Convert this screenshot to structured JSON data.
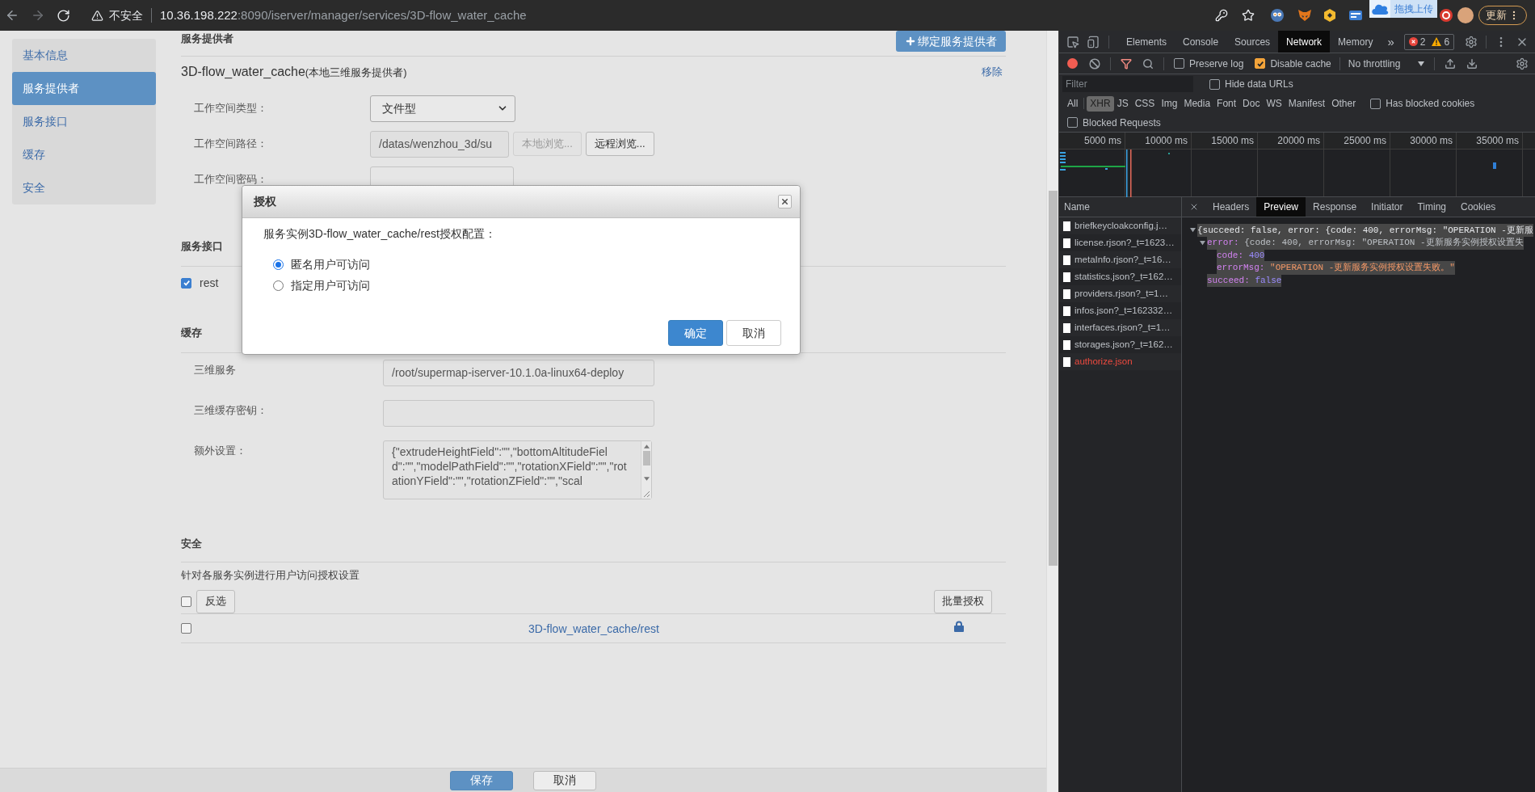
{
  "browser": {
    "security_label": "不安全",
    "url_host": "10.36.198.222",
    "url_rest": ":8090/iserver/manager/services/3D-flow_water_cache",
    "upload_tip": "拖拽上传",
    "update_button": "更新"
  },
  "sidebar": {
    "items": [
      {
        "label": "基本信息",
        "selected": false
      },
      {
        "label": "服务提供者",
        "selected": true
      },
      {
        "label": "服务接口",
        "selected": false
      },
      {
        "label": "缓存",
        "selected": false
      },
      {
        "label": "安全",
        "selected": false
      }
    ]
  },
  "provider": {
    "title": "服务提供者",
    "bind_button": "绑定服务提供者",
    "name": "3D-flow_water_cache",
    "note": "(本地三维服务提供者)",
    "remove_link": "移除",
    "fields": [
      {
        "kind": "select",
        "label": "工作空间类型：",
        "value": "文件型"
      },
      {
        "kind": "path",
        "label": "工作空间路径：",
        "value": "/datas/wenzhou_3d/su",
        "buttons": [
          {
            "label": "本地浏览...",
            "disabled": true
          },
          {
            "label": "远程浏览...",
            "disabled": false
          }
        ]
      },
      {
        "kind": "password",
        "label": "工作空间密码："
      }
    ]
  },
  "interfaces": {
    "title": "服务接口",
    "items": [
      {
        "label": "rest",
        "checked": true
      }
    ]
  },
  "cache": {
    "title": "缓存",
    "fields": [
      {
        "kind": "text",
        "label": "三维服务",
        "value": "/root/supermap-iserver-10.1.0a-linux64-deploy"
      },
      {
        "kind": "text",
        "label": "三维缓存密钥："
      },
      {
        "kind": "textarea",
        "label": "额外设置：",
        "value": "{\"extrudeHeightField\":\"\",\"bottomAltitudeField\":\"\",\"modelPathField\":\"\",\"rotationXField\":\"\",\"rotationYField\":\"\",\"rotationZField\":\"\",\"scal"
      }
    ]
  },
  "security": {
    "title": "安全",
    "description": "针对各服务实例进行用户访问授权设置",
    "select_all_checked": false,
    "invert_button": "反选",
    "batch_button": "批量授权",
    "rows": [
      {
        "name": "3D-flow_water_cache/rest",
        "checked": false
      }
    ]
  },
  "footer": {
    "buttons": [
      {
        "label": "保存",
        "kind": "primary"
      },
      {
        "label": "取消",
        "kind": "default"
      }
    ]
  },
  "dialog": {
    "title": "授权",
    "prompt": "服务实例3D-flow_water_cache/rest授权配置：",
    "options": [
      {
        "label": "匿名用户可访问",
        "selected": true
      },
      {
        "label": "指定用户可访问",
        "selected": false
      }
    ],
    "buttons": [
      {
        "label": "确定",
        "kind": "primary"
      },
      {
        "label": "取消",
        "kind": "default"
      }
    ]
  },
  "devtools": {
    "tabs": [
      {
        "label": "Elements",
        "selected": false
      },
      {
        "label": "Console",
        "selected": false
      },
      {
        "label": "Sources",
        "selected": false
      },
      {
        "label": "Network",
        "selected": true
      },
      {
        "label": "Memory",
        "selected": false
      }
    ],
    "more": "»",
    "errors": "2",
    "warnings": "6",
    "preserve_log": {
      "label": "Preserve log",
      "checked": false
    },
    "disable_cache": {
      "label": "Disable cache",
      "checked": true
    },
    "throttling": "No throttling",
    "filter": {
      "placeholder": "Filter"
    },
    "hide_data_urls": {
      "label": "Hide data URLs",
      "checked": false
    },
    "types": [
      {
        "label": "All",
        "selected": false
      },
      {
        "label": "XHR",
        "selected": true
      },
      {
        "label": "JS",
        "selected": false
      },
      {
        "label": "CSS",
        "selected": false
      },
      {
        "label": "Img",
        "selected": false
      },
      {
        "label": "Media",
        "selected": false
      },
      {
        "label": "Font",
        "selected": false
      },
      {
        "label": "Doc",
        "selected": false
      },
      {
        "label": "WS",
        "selected": false
      },
      {
        "label": "Manifest",
        "selected": false
      },
      {
        "label": "Other",
        "selected": false
      }
    ],
    "has_blocked_cookies": {
      "label": "Has blocked cookies",
      "checked": false
    },
    "blocked_requests": {
      "label": "Blocked Requests",
      "checked": false
    },
    "timeline_ticks": [
      "5000 ms",
      "10000 ms",
      "15000 ms",
      "20000 ms",
      "25000 ms",
      "30000 ms",
      "35000 ms"
    ],
    "name_header": "Name",
    "requests": [
      {
        "name": "briefkeycloakconfig.j…",
        "failed": false
      },
      {
        "name": "license.rjson?_t=1623…",
        "failed": false
      },
      {
        "name": "metaInfo.rjson?_t=16…",
        "failed": false
      },
      {
        "name": "statistics.json?_t=162…",
        "failed": false
      },
      {
        "name": "providers.rjson?_t=1…",
        "failed": false
      },
      {
        "name": "infos.json?_t=162332…",
        "failed": false
      },
      {
        "name": "interfaces.rjson?_t=1…",
        "failed": false
      },
      {
        "name": "storages.json?_t=162…",
        "failed": false
      },
      {
        "name": "authorize.json",
        "failed": true
      }
    ],
    "detail_tabs": [
      {
        "label": "Headers",
        "selected": false
      },
      {
        "label": "Preview",
        "selected": true
      },
      {
        "label": "Response",
        "selected": false
      },
      {
        "label": "Initiator",
        "selected": false
      },
      {
        "label": "Timing",
        "selected": false
      },
      {
        "label": "Cookies",
        "selected": false
      }
    ],
    "preview": {
      "summary": "{succeed: false, error: {code: 400, errorMsg: \"OPERATION -更新服",
      "expanded": true,
      "children": [
        {
          "name": "error:",
          "summary": "{code: 400, errorMsg: \"OPERATION -更新服务实例授权设置失",
          "expanded": true,
          "children": [
            {
              "name": "code:",
              "value": "400",
              "kind": "number"
            },
            {
              "name": "errorMsg:",
              "value": "\"OPERATION -更新服务实例授权设置失败。\"",
              "kind": "string"
            }
          ]
        },
        {
          "name": "succeed:",
          "value": "false",
          "kind": "boolean"
        }
      ]
    }
  }
}
